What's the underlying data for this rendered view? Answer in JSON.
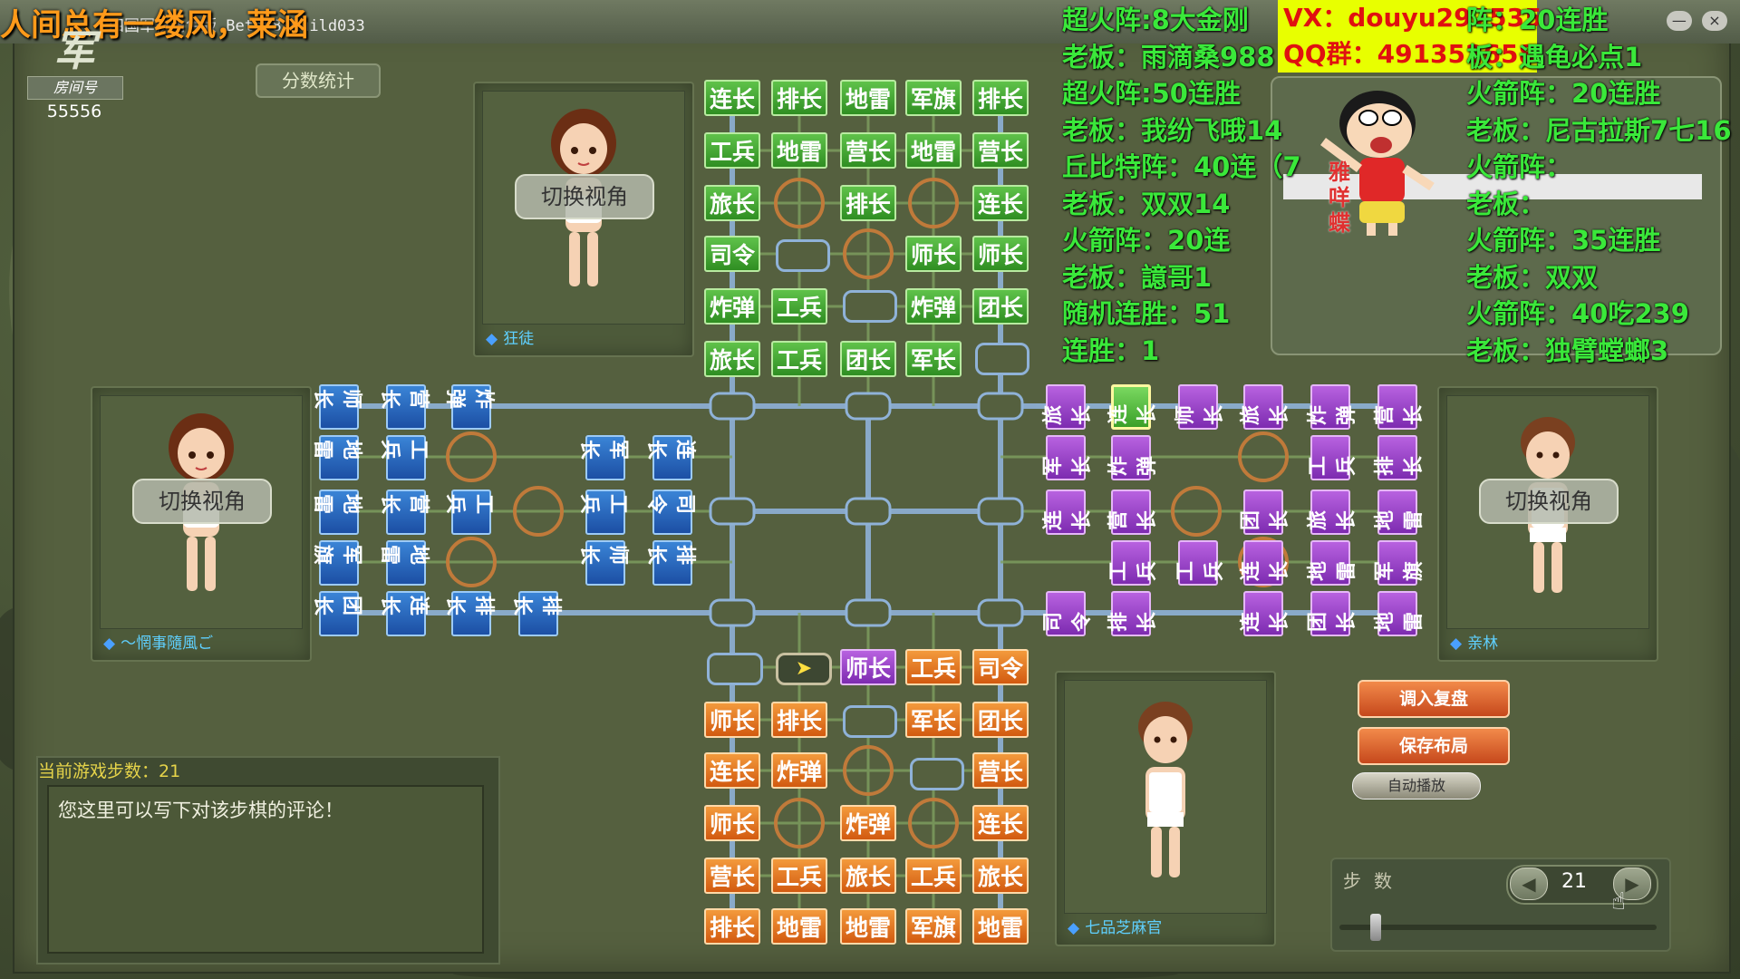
{
  "window": {
    "title": "四国军棋角色版 Beta08 Build033",
    "host_overlay": "人间总有一缕风，莱涵",
    "controls": [
      "—",
      "×"
    ]
  },
  "room": {
    "label": "房间号",
    "number": "55556",
    "logo_text": "军"
  },
  "score_button": "分数统计",
  "players": {
    "top": {
      "name": "狂徒",
      "switch_label": "切换视角"
    },
    "left": {
      "name": "～惘事隨風ご",
      "switch_label": "切换视角"
    },
    "right": {
      "name": "亲林",
      "switch_label": "切换视角"
    },
    "bottom": {
      "name": "七品芝麻官"
    }
  },
  "board": {
    "north_rows": [
      [
        "连长",
        "排长",
        "地雷",
        "军旗",
        "排长"
      ],
      [
        "工兵",
        "地雷",
        "营长",
        "地雷",
        "营长"
      ],
      [
        "旅长",
        "",
        "排长",
        "",
        "连长"
      ],
      [
        "司令",
        "",
        "",
        "师长",
        "师长"
      ],
      [
        "炸弹",
        "工兵",
        "",
        "炸弹",
        "团长"
      ],
      [
        "旅长",
        "工兵",
        "团长",
        "军长",
        ""
      ]
    ],
    "south_rows": [
      [
        "",
        "",
        "师长",
        "工兵",
        "司令"
      ],
      [
        "师长",
        "排长",
        "",
        "军长",
        "团长"
      ],
      [
        "连长",
        "炸弹",
        "",
        "",
        "营长"
      ],
      [
        "师长",
        "",
        "炸弹",
        "",
        "连长"
      ],
      [
        "营长",
        "工兵",
        "旅长",
        "工兵",
        "旅长"
      ],
      [
        "排长",
        "地雷",
        "地雷",
        "军旗",
        "地雷"
      ]
    ],
    "west_cols": [
      [
        "师长",
        "地雷",
        "地雷",
        "军旗",
        "团长"
      ],
      [
        "营长",
        "工兵",
        "营长",
        "地雷",
        "连长"
      ],
      [
        "炸弹",
        "",
        "工兵",
        "",
        "排长"
      ],
      [
        "",
        "",
        "",
        "",
        "排长"
      ],
      [
        "",
        "军长",
        "工兵",
        "师长",
        ""
      ],
      [
        "",
        "连长",
        "司令",
        "排长",
        ""
      ]
    ],
    "east_cols": [
      [
        "旅长",
        "军长",
        "连长",
        "",
        "司令"
      ],
      [
        "连长",
        "炸弹",
        "营长",
        "工兵",
        "排长"
      ],
      [
        "师长",
        "",
        "",
        "工兵",
        ""
      ],
      [
        "旅长",
        "",
        "团长",
        "连长",
        "连长"
      ],
      [
        "炸弹",
        "工兵",
        "旅长",
        "地雷",
        "团长"
      ],
      [
        "营长",
        "排长",
        "地雷",
        "军旗",
        "地雷"
      ]
    ]
  },
  "comment": {
    "step_title": "当前游戏步数：21",
    "placeholder": "您这里可以写下对该步棋的评论！"
  },
  "actions": {
    "load_replay": "调入复盘",
    "save_layout": "保存布局",
    "auto_play": "自动播放"
  },
  "steps": {
    "label": "步数",
    "value": "21",
    "prev": "◀",
    "next": "▶"
  },
  "stream_overlay": {
    "left_lines": [
      "超火阵:8大金刚",
      "老板：雨滴桑988",
      "超火阵:50连胜",
      "老板：我纷飞哦14",
      "丘比特阵：40连（7",
      "老板：双双14",
      "火箭阵：20连",
      "老板：譩哥1",
      "随机连胜：51",
      "连胜：1"
    ],
    "vx": "VX：douyu297535",
    "qq": "QQ群：491352658",
    "right_lines": [
      "阵：20连胜",
      "板：遇龟必点1",
      "火箭阵：20连胜",
      "老板：尼古拉斯7七16",
      "火箭阵：",
      "老板：",
      "火箭阵：35连胜",
      "老板：双双",
      "火箭阵：40吃239",
      "老板：独臂螳螂3"
    ],
    "mascot_text": "雅咩蝶"
  }
}
